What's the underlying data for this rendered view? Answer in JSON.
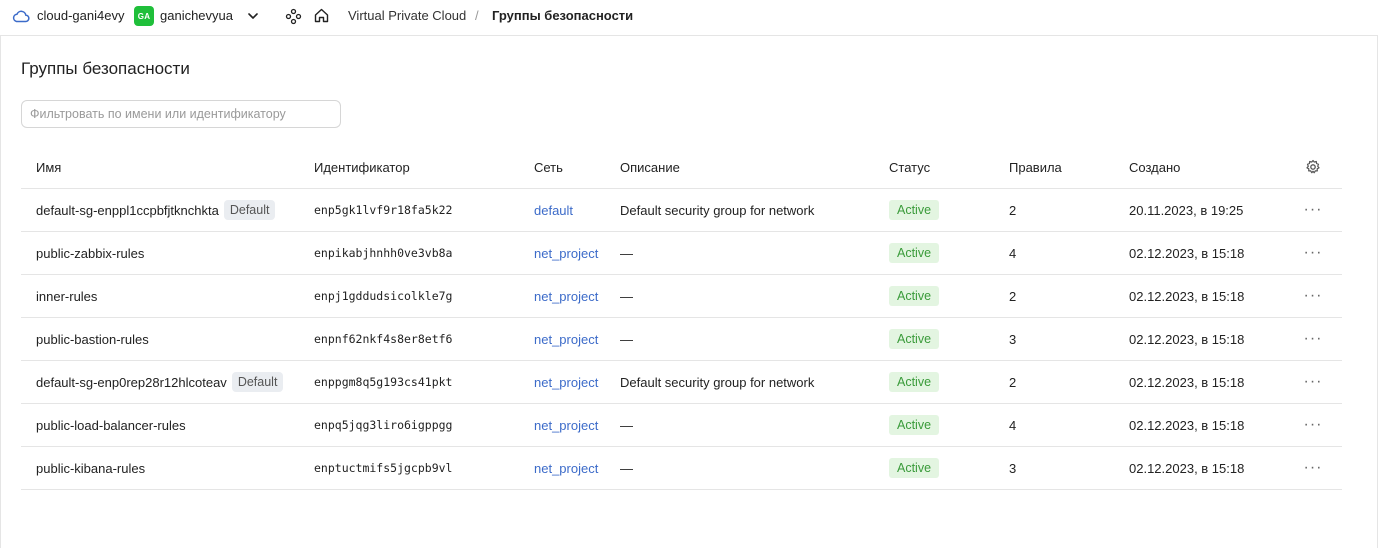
{
  "topbar": {
    "cloud_name": "cloud-gani4evy",
    "user_initials": "GA",
    "user_name": "ganichevyua",
    "breadcrumb_service": "Virtual Private Cloud",
    "breadcrumb_separator": "/",
    "breadcrumb_current": "Группы безопасности",
    "badge_color": "#1fbf3a"
  },
  "page": {
    "title": "Группы безопасности",
    "filter_placeholder": "Фильтровать по имени или идентификатору"
  },
  "table": {
    "columns": {
      "name": "Имя",
      "id": "Идентификатор",
      "network": "Сеть",
      "description": "Описание",
      "status": "Статус",
      "rules": "Правила",
      "created": "Создано"
    },
    "rows": [
      {
        "name": "default-sg-enppl1ccpbfjtknchkta",
        "default_badge": "Default",
        "id": "enp5gk1lvf9r18fa5k22",
        "network": "default",
        "description": "Default security group for network",
        "status": "Active",
        "rules": "2",
        "created": "20.11.2023, в 19:25"
      },
      {
        "name": "public-zabbix-rules",
        "default_badge": "",
        "id": "enpikabjhnhh0ve3vb8a",
        "network": "net_project",
        "description": "—",
        "status": "Active",
        "rules": "4",
        "created": "02.12.2023, в 15:18"
      },
      {
        "name": "inner-rules",
        "default_badge": "",
        "id": "enpj1gddudsicolkle7g",
        "network": "net_project",
        "description": "—",
        "status": "Active",
        "rules": "2",
        "created": "02.12.2023, в 15:18"
      },
      {
        "name": "public-bastion-rules",
        "default_badge": "",
        "id": "enpnf62nkf4s8er8etf6",
        "network": "net_project",
        "description": "—",
        "status": "Active",
        "rules": "3",
        "created": "02.12.2023, в 15:18"
      },
      {
        "name": "default-sg-enp0rep28r12hlcoteav",
        "default_badge": "Default",
        "id": "enppgm8q5g193cs41pkt",
        "network": "net_project",
        "description": "Default security group for network",
        "status": "Active",
        "rules": "2",
        "created": "02.12.2023, в 15:18"
      },
      {
        "name": "public-load-balancer-rules",
        "default_badge": "",
        "id": "enpq5jqg3liro6igppgg",
        "network": "net_project",
        "description": "—",
        "status": "Active",
        "rules": "4",
        "created": "02.12.2023, в 15:18"
      },
      {
        "name": "public-kibana-rules",
        "default_badge": "",
        "id": "enptuctmifs5jgcpb9vl",
        "network": "net_project",
        "description": "—",
        "status": "Active",
        "rules": "3",
        "created": "02.12.2023, в 15:18"
      }
    ],
    "actions_glyph": "···"
  }
}
